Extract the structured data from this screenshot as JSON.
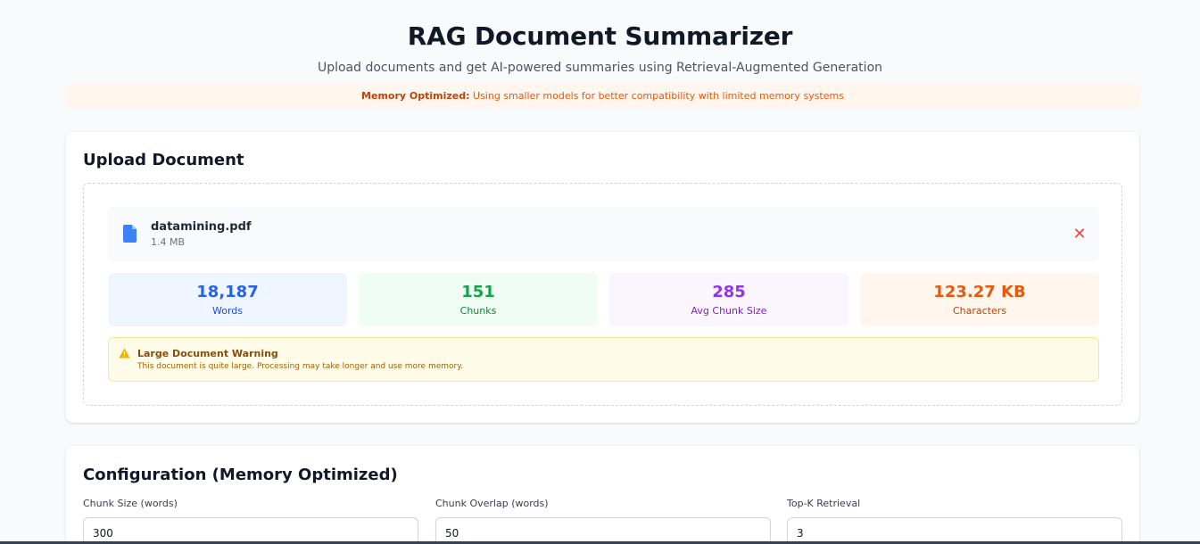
{
  "header": {
    "title": "RAG Document Summarizer",
    "subtitle": "Upload documents and get AI-powered summaries using Retrieval-Augmented Generation"
  },
  "memory_banner": {
    "label": "Memory Optimized:",
    "text": " Using smaller models for better compatibility with limited memory systems"
  },
  "upload": {
    "title": "Upload Document",
    "file": {
      "name": "datamining.pdf",
      "size": "1.4 MB",
      "icon": "document-icon",
      "remove_icon": "close-icon",
      "remove_glyph": "✕"
    },
    "stats": [
      {
        "value": "18,187",
        "label": "Words"
      },
      {
        "value": "151",
        "label": "Chunks"
      },
      {
        "value": "285",
        "label": "Avg Chunk Size"
      },
      {
        "value": "123.27 KB",
        "label": "Characters"
      }
    ],
    "warning": {
      "icon": "warning-triangle-icon",
      "title": "Large Document Warning",
      "text": "This document is quite large. Processing may take longer and use more memory."
    }
  },
  "config": {
    "title": "Configuration (Memory Optimized)",
    "fields": [
      {
        "label": "Chunk Size (words)",
        "value": "300"
      },
      {
        "label": "Chunk Overlap (words)",
        "value": "50"
      },
      {
        "label": "Top-K Retrieval",
        "value": "3"
      }
    ]
  },
  "colors": {
    "primary_text": "#111827",
    "banner_orange": "#ea580c",
    "file_icon_blue": "#3b82f6",
    "remove_red": "#ef4444",
    "warning_amber": "#eab308"
  }
}
